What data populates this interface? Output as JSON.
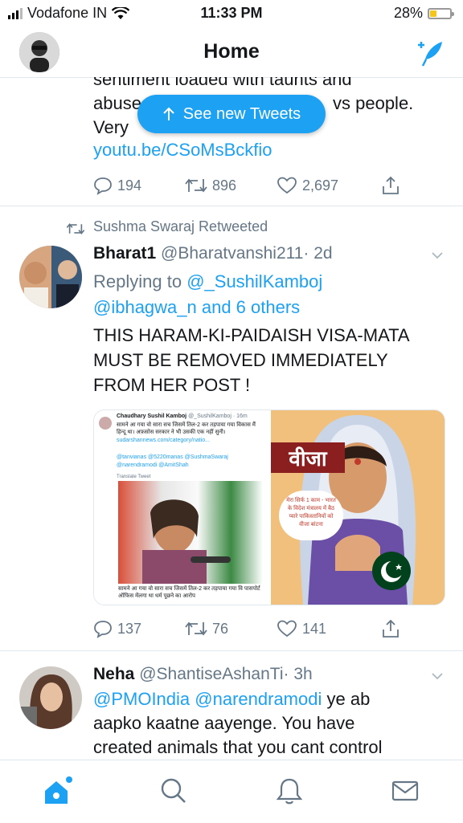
{
  "status_bar": {
    "carrier": "Vodafone IN",
    "time": "11:33 PM",
    "battery": "28%"
  },
  "header": {
    "title": "Home"
  },
  "new_tweets_pill": {
    "label": "See new Tweets"
  },
  "tweet1": {
    "text_line1": "sentiment loaded with taunts and",
    "text_line2_start": "abuse",
    "text_line2_end": "vs people.",
    "text_line3": "Very",
    "link": "youtu.be/CSoMsBckfio",
    "replies": "194",
    "retweets": "896",
    "likes": "2,697"
  },
  "tweet2": {
    "retweeted_by": "Sushma Swaraj Retweeted",
    "name": "Bharat1",
    "handle": "@Bharatvanshi211",
    "time": "· 2d",
    "replying_prefix": "Replying to",
    "replying_user": "@_SushilKamboj",
    "replying_rest": "@ibhagwa_n and 6 others",
    "text": "THIS HARAM-KI-PAIDAISH VISA-MATA MUST BE REMOVED IMMEDIATELY FROM HER POST !",
    "media_left": {
      "author": "Chaudhary Sushil Kamboj",
      "author_handle": "@_SushilKamboj · 16m",
      "body": "सामने आ गया वो सारा सच जिसमें तिल-2 कर तड़पाया गया विकास मैं हिन्दू था। अफ़सोस सरकार ने भी उसकी एक नहीं सुनी।",
      "link": "sudarshannews.com/category/natio...",
      "mentions": "@tanvianas @5220manas @SushmaSwaraj @narendramodi @AmitShah",
      "translate": "Translate Tweet",
      "caption": "सामने आ गया वो सारा सच जिसमें तिल-2 कर तड़पाया गया वि पासपोर्ट ऑफिस मेंलगा था धर्म पूछने का आरोप"
    },
    "media_right": {
      "title": "वीजा",
      "bubble": "मेरा सिर्फ 1 काम - भारत के विदेश मंत्रालय में बैठ प्यारे पाकिस्तानियों को वीजा बांटना"
    },
    "replies": "137",
    "retweets": "76",
    "likes": "141"
  },
  "tweet3": {
    "name": "Neha",
    "handle": "@ShantiseAshanTi",
    "time": "· 3h",
    "mention1": "@PMOIndia",
    "mention2": "@narendramodi",
    "text_line1_rest": "ye ab",
    "text_line2": "aapko kaatne aayenge. You have",
    "text_line3": "created animals that you cant control"
  },
  "icons": {
    "reply": "reply-icon",
    "retweet": "retweet-icon",
    "like": "heart-icon",
    "share": "share-icon",
    "home": "home-icon",
    "search": "search-icon",
    "notifications": "bell-icon",
    "messages": "mail-icon"
  },
  "colors": {
    "accent": "#1da1f2",
    "secondary": "#657786",
    "text": "#14171a"
  }
}
